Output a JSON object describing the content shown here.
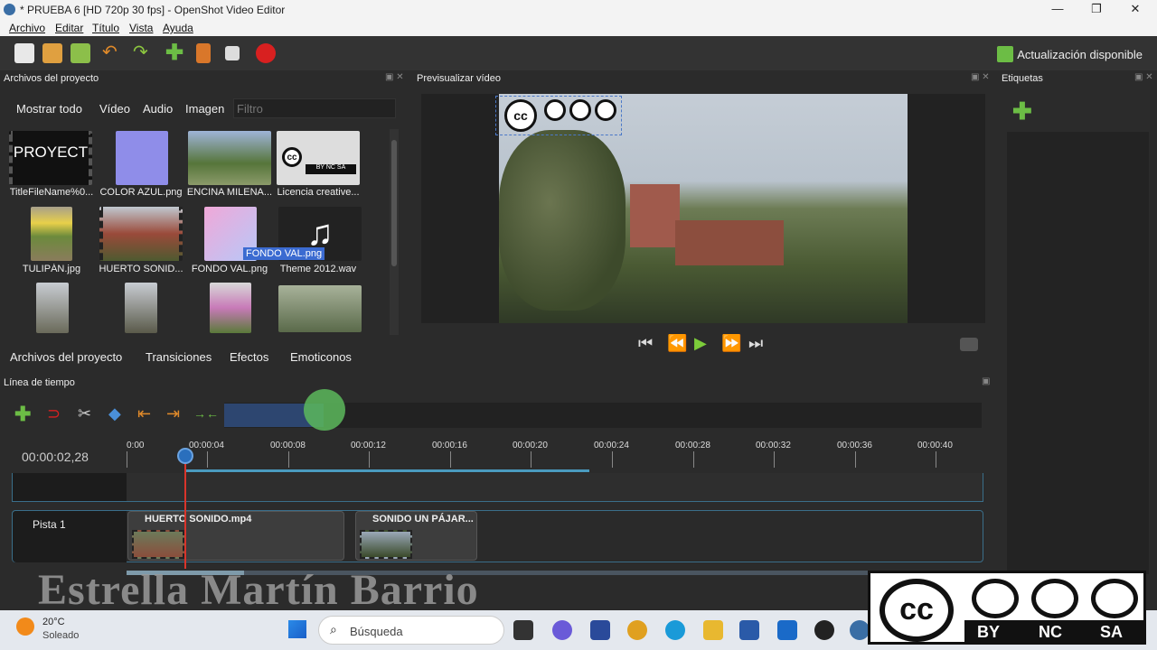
{
  "window": {
    "title": "* PRUEBA 6 [HD 720p 30 fps] - OpenShot Video Editor",
    "minimize": "—",
    "maximize": "❐",
    "close": "✕"
  },
  "menu": [
    "Archivo",
    "Editar",
    "Título",
    "Vista",
    "Ayuda"
  ],
  "toolbar": {
    "update_label": "Actualización disponible"
  },
  "panels": {
    "files": "Archivos del proyecto",
    "preview": "Previsualizar vídeo",
    "tags": "Etiquetas",
    "timeline": "Línea de tiempo"
  },
  "file_filters": [
    "Mostrar todo",
    "Vídeo",
    "Audio",
    "Imagen"
  ],
  "filter_placeholder": "Filtro",
  "files": [
    {
      "name": "TitleFileName%0..."
    },
    {
      "name": "COLOR AZUL.png"
    },
    {
      "name": "ENCINA MILENA..."
    },
    {
      "name": "Licencia creative..."
    },
    {
      "name": "TULIPÁN.jpg"
    },
    {
      "name": "HUERTO SONID..."
    },
    {
      "name": "FONDO VAL.png"
    },
    {
      "name": "Theme 2012.wav"
    },
    {
      "name": ""
    },
    {
      "name": ""
    },
    {
      "name": ""
    },
    {
      "name": ""
    }
  ],
  "thumb_text": {
    "proyect": "PROYECT",
    "cc_sub": "BY  NC  SA"
  },
  "tooltip": "FONDO VAL.png",
  "bottom_tabs": [
    "Archivos del proyecto",
    "Transiciones",
    "Efectos",
    "Emoticonos"
  ],
  "timeline": {
    "timecode": "00:00:02,28",
    "ticks": [
      "0:00",
      "00:00:04",
      "00:00:08",
      "00:00:12",
      "00:00:16",
      "00:00:20",
      "00:00:24",
      "00:00:28",
      "00:00:32",
      "00:00:36",
      "00:00:40"
    ],
    "track_name": "Pista 1",
    "clips": [
      {
        "name": "HUERTO SONIDO.mp4"
      },
      {
        "name": "SONIDO UN PÁJAR..."
      }
    ]
  },
  "watermark": "Estrella Martín Barrio",
  "cc_logo": {
    "cc": "cc",
    "by": "BY",
    "nc": "NC",
    "sa": "SA"
  },
  "taskbar": {
    "temp": "20°C",
    "condition": "Soleado",
    "search": "Búsqueda"
  }
}
